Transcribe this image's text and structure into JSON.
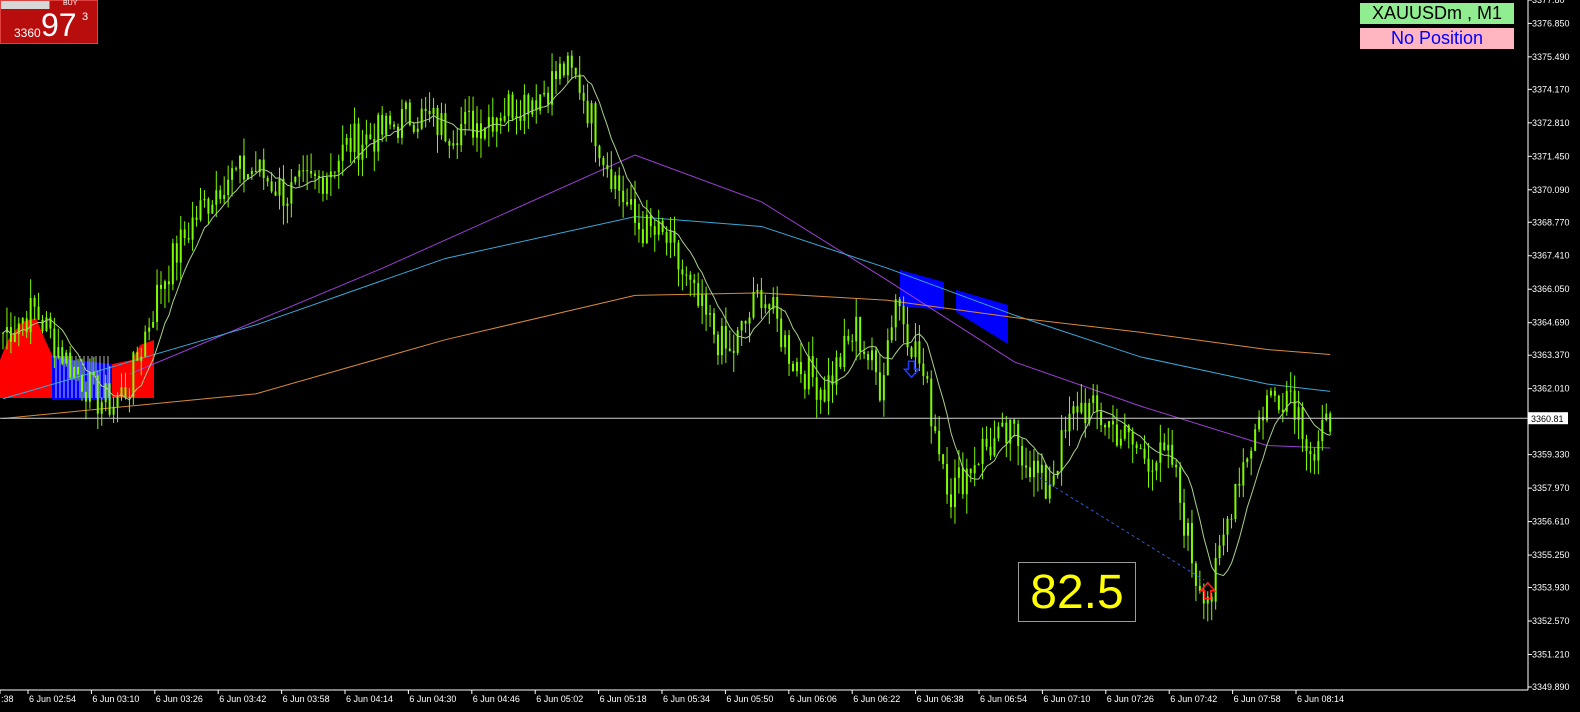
{
  "trade_panel": {
    "top_left_label": "1.00",
    "buy_label": "BUY",
    "price_small": "3360",
    "price_big": "97",
    "price_sup": "3"
  },
  "symbol_label": "XAUUSDm , M1",
  "position_label": "No Position",
  "measure_value": "82.5",
  "current_price_label": "3360.81",
  "price_axis": {
    "ticks": [
      "3377.80",
      "3376.850",
      "3375.490",
      "3374.170",
      "3372.810",
      "3371.450",
      "3370.090",
      "3368.770",
      "3367.410",
      "3366.050",
      "3364.690",
      "3363.370",
      "3362.010",
      "3359.330",
      "3357.970",
      "3356.610",
      "3355.250",
      "3353.930",
      "3352.570",
      "3351.210",
      "3349.890"
    ]
  },
  "time_axis": {
    "ticks": [
      ":38",
      "6 Jun 02:54",
      "6 Jun 03:10",
      "6 Jun 03:26",
      "6 Jun 03:42",
      "6 Jun 03:58",
      "6 Jun 04:14",
      "6 Jun 04:30",
      "6 Jun 04:46",
      "6 Jun 05:02",
      "6 Jun 05:18",
      "6 Jun 05:34",
      "6 Jun 05:50",
      "6 Jun 06:06",
      "6 Jun 06:22",
      "6 Jun 06:38",
      "6 Jun 06:54",
      "6 Jun 07:10",
      "6 Jun 07:26",
      "6 Jun 07:42",
      "6 Jun 07:58",
      "6 Jun 08:14"
    ]
  },
  "colors": {
    "background": "#000000",
    "candle": "#7cfc00",
    "ma_fast": "#a8d08d",
    "ma_purple": "#9a3fd3",
    "ma_blue": "#3ba9d8",
    "ma_orange": "#d98a3c",
    "band_red": "#ff0000",
    "band_blue": "#0000ff",
    "axis_text": "#ffffff",
    "price_line": "#d0d0d0"
  },
  "chart_data": {
    "type": "candlestick",
    "symbol": "XAUUSDm",
    "timeframe": "M1",
    "ylim": [
      3349.89,
      3377.8
    ],
    "current_price": 3360.81,
    "close_path": {
      "time": [
        "02:38",
        "02:46",
        "02:54",
        "03:02",
        "03:06",
        "03:10",
        "03:18",
        "03:26",
        "03:34",
        "03:42",
        "03:50",
        "03:58",
        "04:06",
        "04:14",
        "04:22",
        "04:30",
        "04:38",
        "04:46",
        "04:54",
        "05:00",
        "05:04",
        "05:10",
        "05:18",
        "05:26",
        "05:34",
        "05:42",
        "05:50",
        "05:58",
        "06:06",
        "06:14",
        "06:20",
        "06:24",
        "06:30",
        "06:38",
        "06:46",
        "06:54",
        "07:02",
        "07:10",
        "07:18",
        "07:26",
        "07:34",
        "07:40",
        "07:44",
        "07:50",
        "07:58",
        "08:04",
        "08:10",
        "08:14"
      ],
      "close": [
        3364.3,
        3365.2,
        3363.2,
        3361.6,
        3361.4,
        3362.2,
        3366.3,
        3368.8,
        3370.6,
        3370.9,
        3369.9,
        3370.5,
        3372.0,
        3372.4,
        3373.2,
        3372.6,
        3372.8,
        3373.5,
        3374.0,
        3375.0,
        3374.4,
        3371.6,
        3368.7,
        3368.0,
        3365.3,
        3363.3,
        3366.0,
        3363.2,
        3362.0,
        3364.4,
        3362.2,
        3365.8,
        3363.1,
        3357.8,
        3359.6,
        3360.1,
        3357.9,
        3361.4,
        3360.6,
        3359.4,
        3359.0,
        3354.4,
        3353.6,
        3358.2,
        3361.6,
        3362.0,
        3359.2,
        3360.8
      ]
    },
    "moving_averages": [
      {
        "color": "#9a3fd3",
        "time": [
          "03:10",
          "04:14",
          "05:18",
          "05:50",
          "06:22",
          "06:54",
          "07:26",
          "07:58",
          "08:14"
        ],
        "value": [
          3362.6,
          3366.9,
          3371.5,
          3369.6,
          3366.4,
          3363.1,
          3361.3,
          3359.7,
          3359.6
        ]
      },
      {
        "color": "#3ba9d8",
        "time": [
          "02:38",
          "03:42",
          "04:30",
          "05:18",
          "05:50",
          "06:22",
          "06:54",
          "07:26",
          "07:58",
          "08:14"
        ],
        "value": [
          3361.6,
          3364.6,
          3367.3,
          3369.0,
          3368.6,
          3366.9,
          3365.0,
          3363.3,
          3362.2,
          3361.9
        ]
      },
      {
        "color": "#d98a3c",
        "time": [
          "02:38",
          "03:42",
          "04:30",
          "05:18",
          "05:50",
          "06:22",
          "06:54",
          "07:26",
          "07:58",
          "08:14"
        ],
        "value": [
          3360.8,
          3361.8,
          3364.0,
          3365.8,
          3365.9,
          3365.6,
          3364.9,
          3364.3,
          3363.6,
          3363.4
        ]
      }
    ],
    "signals": [
      {
        "type": "sell",
        "time": "06:28",
        "price": 3362.8
      },
      {
        "type": "buy",
        "time": "07:43",
        "price": 3353.8
      }
    ]
  }
}
